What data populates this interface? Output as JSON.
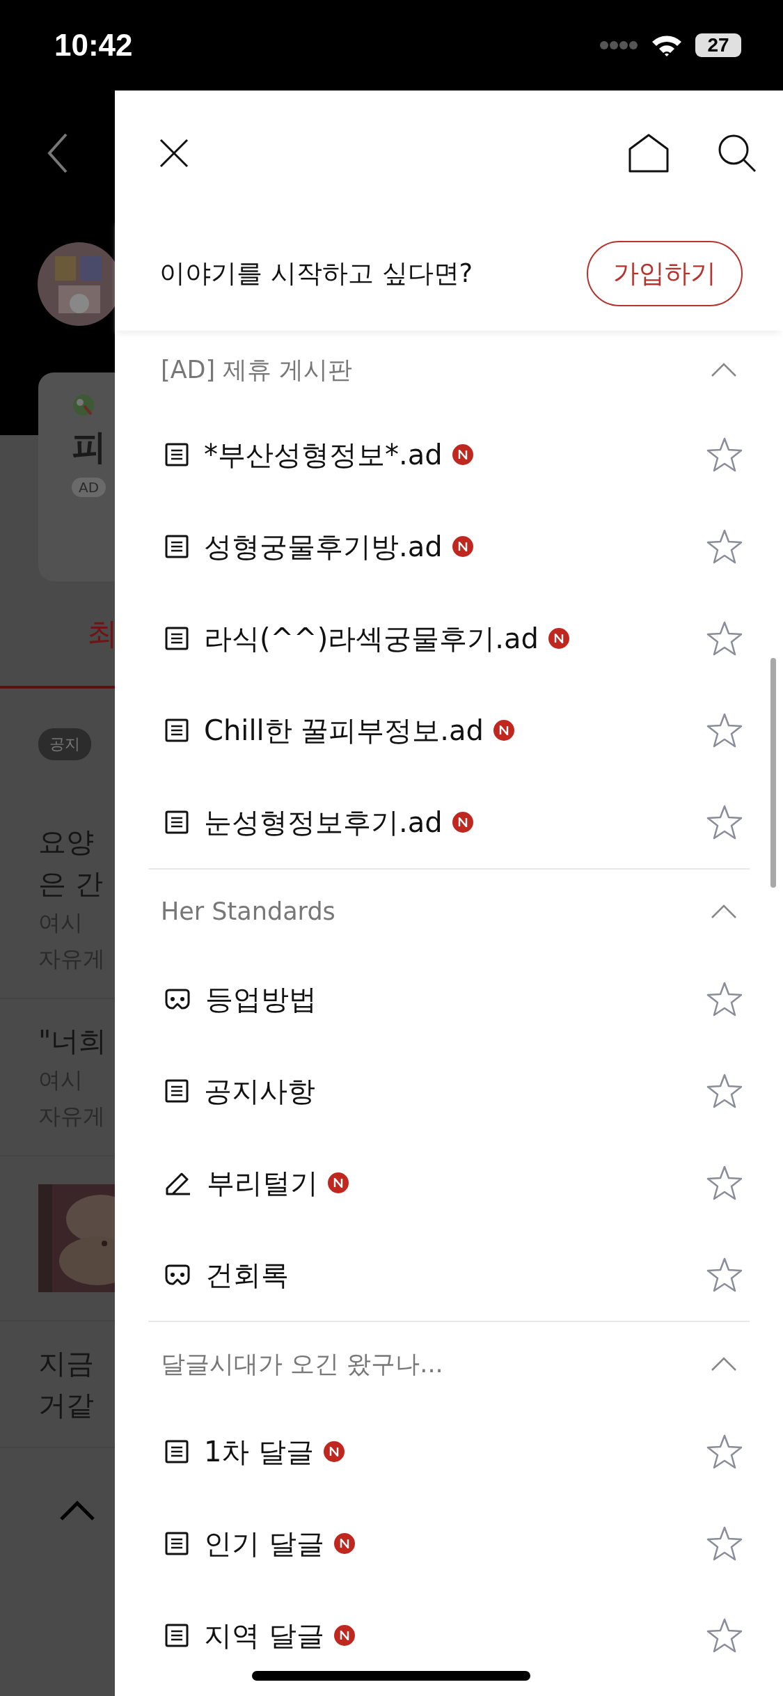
{
  "status_bar": {
    "time": "10:42",
    "battery": "27"
  },
  "background_page": {
    "card_title": "피",
    "card_badge": "AD",
    "tab": "최",
    "notice_badge": "공지",
    "posts": [
      {
        "kind": "text",
        "lines": [
          "요양",
          "은 간"
        ],
        "meta": [
          "여시",
          "자유게"
        ]
      },
      {
        "kind": "text",
        "lines": [
          "\"너희"
        ],
        "meta": [
          "여시",
          "자유게"
        ]
      },
      {
        "kind": "picture"
      },
      {
        "kind": "text",
        "lines": [
          "지금",
          "거같"
        ]
      }
    ]
  },
  "drawer": {
    "join_prompt": "이야기를 시작하고 싶다면?",
    "join_button": "가입하기",
    "sections": [
      {
        "title": "[AD] 제휴 게시판",
        "expanded": true,
        "items": [
          {
            "kind": "board",
            "label": "*부산성형정보*.ad",
            "new": true,
            "favorite": false
          },
          {
            "kind": "board",
            "label": "성형궁물후기방.ad",
            "new": true,
            "favorite": false
          },
          {
            "kind": "board",
            "label": "라식(^^)라섹궁물후기.ad",
            "new": true,
            "favorite": false
          },
          {
            "kind": "board",
            "label": "Chill한 꿀피부정보.ad",
            "new": true,
            "favorite": false
          },
          {
            "kind": "board",
            "label": "눈성형정보후기.ad",
            "new": true,
            "favorite": false
          }
        ]
      },
      {
        "title": "Her Standards",
        "expanded": true,
        "items": [
          {
            "kind": "gallery",
            "label": "등업방법",
            "new": false,
            "favorite": false
          },
          {
            "kind": "board",
            "label": "공지사항",
            "new": false,
            "favorite": false
          },
          {
            "kind": "write",
            "label": "부리털기",
            "new": true,
            "favorite": false
          },
          {
            "kind": "gallery",
            "label": "건회록",
            "new": false,
            "favorite": false
          }
        ]
      },
      {
        "title": "달글시대가 오긴 왔구나...",
        "expanded": true,
        "items": [
          {
            "kind": "board",
            "label": "1차 달글",
            "new": true,
            "favorite": false
          },
          {
            "kind": "board",
            "label": "인기 달글",
            "new": true,
            "favorite": false
          },
          {
            "kind": "board",
            "label": "지역 달글",
            "new": true,
            "favorite": false
          }
        ]
      }
    ]
  }
}
